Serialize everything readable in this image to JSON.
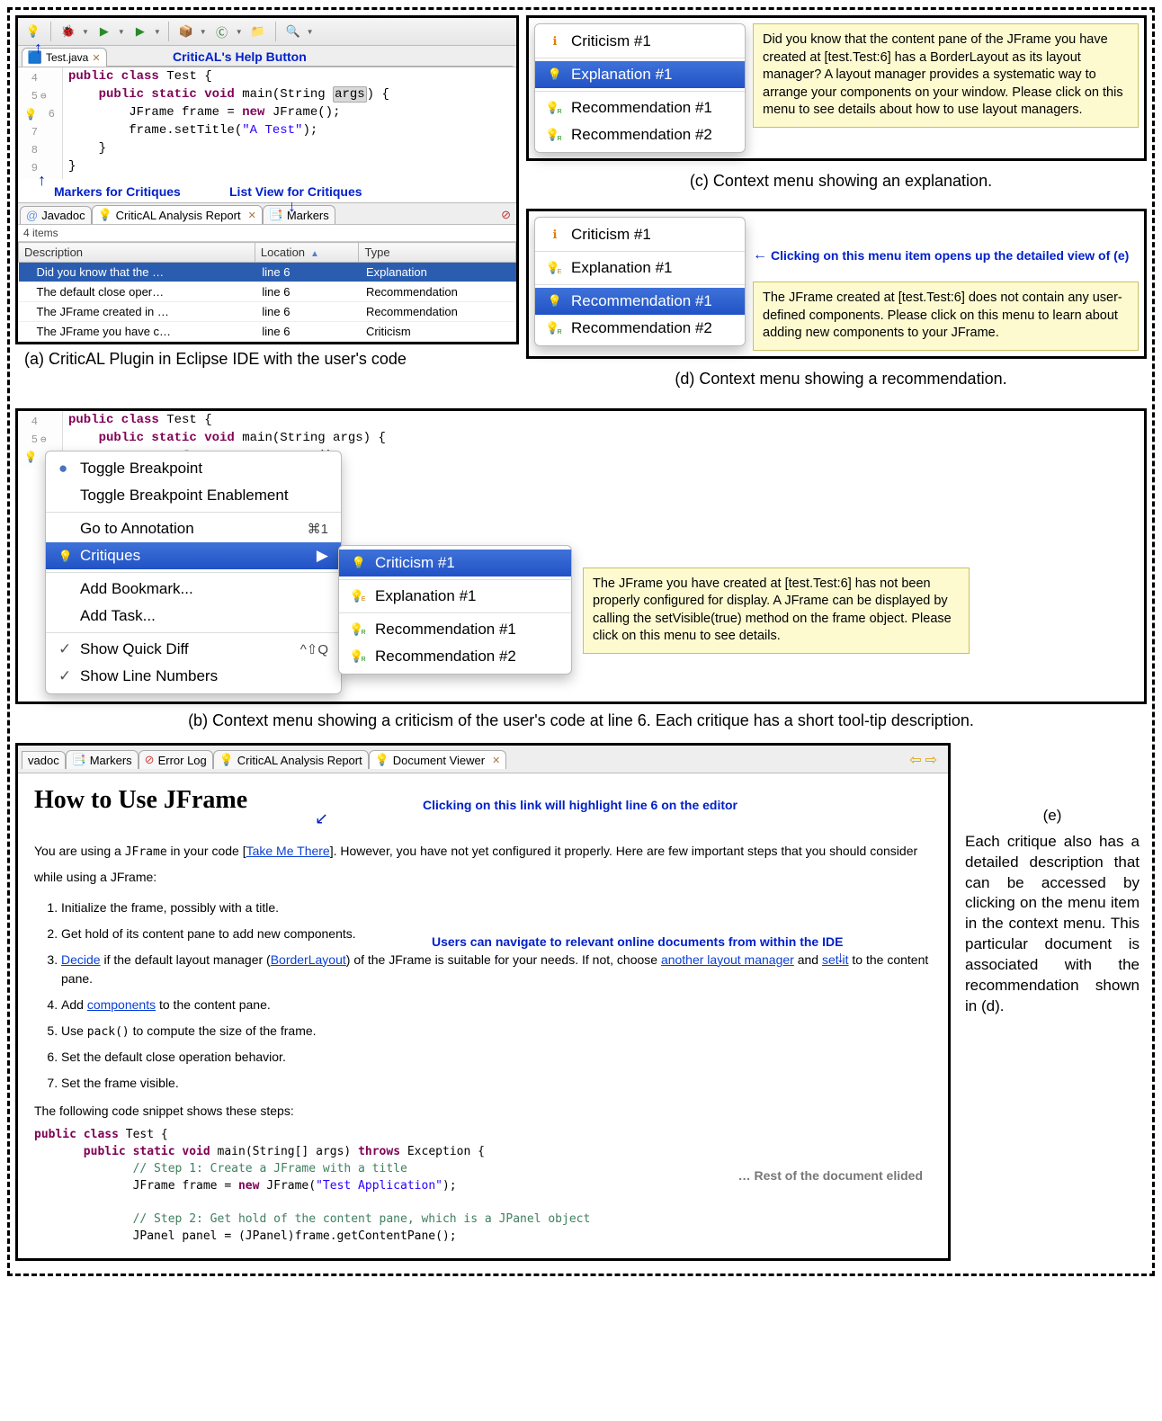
{
  "aPanel": {
    "fileTab": "Test.java",
    "anno_help": "CriticAL's Help Button",
    "anno_markers": "Markers for Critiques",
    "anno_listview": "List View for Critiques",
    "lineStart": 4,
    "code": {
      "l4": "public class Test {",
      "l5a": "public static void main(String ",
      "l5arg": "args",
      "l5b": ") {",
      "l6a": "JFrame frame = ",
      "l6new": "new",
      "l6b": " JFrame();",
      "l7a": "frame.setTitle(",
      "l7str": "\"A Test\"",
      "l7b": ");",
      "l8": "}",
      "l9": "}"
    },
    "bottomTabs": {
      "javadoc": "Javadoc",
      "critical": "CriticAL Analysis Report",
      "markers": "Markers"
    },
    "itemsLabel": "4 items",
    "cols": {
      "desc": "Description",
      "loc": "Location",
      "type": "Type"
    },
    "rows": [
      {
        "desc": "Did you know that the …",
        "loc": "line 6",
        "type": "Explanation"
      },
      {
        "desc": "The default close oper…",
        "loc": "line 6",
        "type": "Recommendation"
      },
      {
        "desc": "The JFrame created in …",
        "loc": "line 6",
        "type": "Recommendation"
      },
      {
        "desc": "The JFrame you have c…",
        "loc": "line 6",
        "type": "Criticism"
      }
    ],
    "caption": "(a) CriticAL Plugin in Eclipse IDE with the user's code"
  },
  "cPanel": {
    "items": [
      {
        "label": "Criticism #1",
        "kind": "crit"
      },
      {
        "label": "Explanation #1",
        "kind": "exp",
        "sel": true
      },
      {
        "label": "Recommendation #1",
        "kind": "rec"
      },
      {
        "label": "Recommendation #2",
        "kind": "rec"
      }
    ],
    "tooltip": "Did you know that the content pane of the JFrame you have created at [test.Test:6] has a BorderLayout as its layout manager? A layout manager provides a systematic way to arrange your components on your window. Please click on this menu to see details about how to use layout managers.",
    "caption": "(c) Context menu showing an explanation."
  },
  "dPanel": {
    "items": [
      {
        "label": "Criticism #1",
        "kind": "crit"
      },
      {
        "label": "Explanation #1",
        "kind": "exp"
      },
      {
        "label": "Recommendation #1",
        "kind": "rec",
        "sel": true
      },
      {
        "label": "Recommendation #2",
        "kind": "rec"
      }
    ],
    "anno": "Clicking on this menu item opens up the detailed view of (e)",
    "tooltip": "The JFrame created at [test.Test:6] does not contain any user-defined components. Please click on this menu to learn about adding new components to your JFrame.",
    "caption": "(d) Context menu showing a recommendation."
  },
  "bPanel": {
    "codeTop": {
      "l4": "public class Test {",
      "l5": "public static void main(String args) {",
      "l6": "();"
    },
    "mainMenu": [
      {
        "label": "Toggle Breakpoint",
        "dot": true
      },
      {
        "label": "Toggle Breakpoint Enablement"
      },
      {
        "sep": true
      },
      {
        "label": "Go to Annotation",
        "shortcut": "⌘1"
      },
      {
        "label": "Critiques",
        "bulb": true,
        "sel": true,
        "sub": true
      },
      {
        "sep": true
      },
      {
        "label": "Add Bookmark..."
      },
      {
        "label": "Add Task..."
      },
      {
        "sep": true
      },
      {
        "label": "Show Quick Diff",
        "check": true,
        "shortcut": "^⇧Q"
      },
      {
        "label": "Show Line Numbers",
        "check": true
      }
    ],
    "subMenu": [
      {
        "label": "Criticism #1",
        "kind": "crit",
        "sel": true
      },
      {
        "label": "Explanation #1",
        "kind": "exp"
      },
      {
        "label": "Recommendation #1",
        "kind": "rec"
      },
      {
        "label": "Recommendation #2",
        "kind": "rec"
      }
    ],
    "tooltip": "The JFrame you have created at [test.Test:6] has not been properly configured for display. A JFrame can be displayed by calling the setVisible(true) method on the frame object. Please click on this menu to see details.",
    "caption": "(b) Context menu showing a criticism of the user's code at line 6. Each critique has a short tool-tip description."
  },
  "ePanel": {
    "tabs": [
      "Javadoc",
      "Markers",
      "Error Log",
      "CriticAL Analysis Report",
      "Document Viewer"
    ],
    "title": "How to Use JFrame",
    "anno_link": "Clicking on this link will highlight line 6 on the editor",
    "anno_nav": "Users can navigate to relevant online documents from within the IDE",
    "intro_a": "You are using a ",
    "intro_code": "JFrame",
    "intro_b": " in your code [",
    "intro_link": "Take Me There",
    "intro_c": "]. However, you have not yet configured it properly. Here are few important steps that you should consider while using a JFrame:",
    "steps": {
      "s1": "Initialize the frame, possibly with a title.",
      "s2": "Get hold of its content pane to add new components.",
      "s3a": "Decide",
      "s3b": " if the default layout manager (",
      "s3c": "BorderLayout",
      "s3d": ") of the JFrame is suitable for your needs. If not, choose ",
      "s3e": "another layout manager",
      "s3f": " and ",
      "s3g": "set it",
      "s3h": " to the content pane.",
      "s4a": "Add ",
      "s4b": "components",
      "s4c": " to the content pane.",
      "s5a": "Use ",
      "s5b": "pack()",
      "s5c": " to compute the size of the frame.",
      "s6": "Set the default close operation behavior.",
      "s7": "Set the frame visible."
    },
    "snippet_intro": "The following code snippet shows these steps:",
    "elided": "… Rest of the document elided",
    "code": {
      "c1a": "public class",
      "c1b": " Test {",
      "c2a": "public static void",
      "c2b": " main(String[] args) ",
      "c2c": "throws",
      "c2d": " Exception {",
      "c3": "// Step 1: Create a JFrame with a title",
      "c4a": "JFrame frame = ",
      "c4b": "new",
      "c4c": " JFrame(",
      "c4d": "\"Test Application\"",
      "c4e": ");",
      "c5": "// Step 2: Get hold of the content pane, which is a JPanel object",
      "c6": "JPanel panel = (JPanel)frame.getContentPane();"
    },
    "sideLabel": "(e)",
    "sideText": "Each critique also has a detailed description that can be accessed by clicking on the menu item in the context menu. This particular document is associated with the recommendation shown in (d)."
  }
}
